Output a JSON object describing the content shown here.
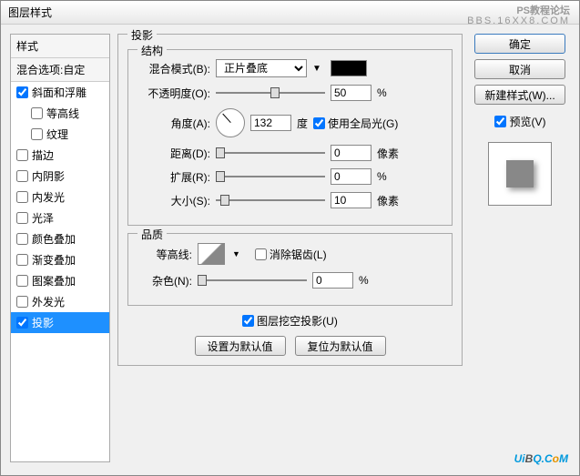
{
  "title": "图层样式",
  "watermark_top": "PS教程论坛",
  "watermark_url": "BBS.16XX8.COM",
  "watermark_bottom": "UiBQ.CoM",
  "left": {
    "header": "样式",
    "sub": "混合选项:自定",
    "items": [
      {
        "label": "斜面和浮雕",
        "checked": true,
        "indent": false
      },
      {
        "label": "等高线",
        "checked": false,
        "indent": true
      },
      {
        "label": "纹理",
        "checked": false,
        "indent": true
      },
      {
        "label": "描边",
        "checked": false,
        "indent": false
      },
      {
        "label": "内阴影",
        "checked": false,
        "indent": false
      },
      {
        "label": "内发光",
        "checked": false,
        "indent": false
      },
      {
        "label": "光泽",
        "checked": false,
        "indent": false
      },
      {
        "label": "颜色叠加",
        "checked": false,
        "indent": false
      },
      {
        "label": "渐变叠加",
        "checked": false,
        "indent": false
      },
      {
        "label": "图案叠加",
        "checked": false,
        "indent": false
      },
      {
        "label": "外发光",
        "checked": false,
        "indent": false
      },
      {
        "label": "投影",
        "checked": true,
        "indent": false,
        "selected": true
      }
    ]
  },
  "main": {
    "section_title": "投影",
    "structure": {
      "group": "结构",
      "blend_label": "混合模式(B):",
      "blend_value": "正片叠底",
      "opacity_label": "不透明度(O):",
      "opacity_value": "50",
      "opacity_unit": "%",
      "angle_label": "角度(A):",
      "angle_value": "132",
      "angle_unit": "度",
      "global_light": "使用全局光(G)",
      "distance_label": "距离(D):",
      "distance_value": "0",
      "distance_unit": "像素",
      "spread_label": "扩展(R):",
      "spread_value": "0",
      "spread_unit": "%",
      "size_label": "大小(S):",
      "size_value": "10",
      "size_unit": "像素"
    },
    "quality": {
      "group": "品质",
      "contour_label": "等高线:",
      "antialias": "消除锯齿(L)",
      "noise_label": "杂色(N):",
      "noise_value": "0",
      "noise_unit": "%"
    },
    "knockout": "图层挖空投影(U)",
    "set_default": "设置为默认值",
    "reset_default": "复位为默认值"
  },
  "right": {
    "ok": "确定",
    "cancel": "取消",
    "new_style": "新建样式(W)...",
    "preview": "预览(V)"
  }
}
